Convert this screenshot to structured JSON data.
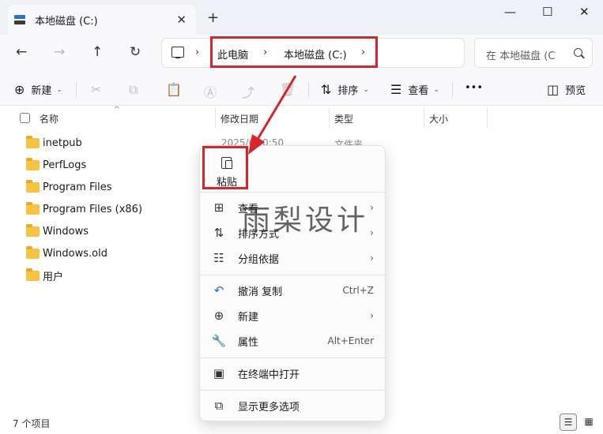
{
  "window": {
    "tab_title": "本地磁盘 (C:)",
    "tab_close_glyph": "✕",
    "new_tab_glyph": "+",
    "minimize_glyph": "—",
    "maximize_glyph": "☐",
    "close_glyph": "✕"
  },
  "nav": {
    "back_glyph": "←",
    "forward_glyph": "→",
    "up_glyph": "↑",
    "refresh_glyph": "↻",
    "chevron_glyph": "›",
    "breadcrumbs": [
      "此电脑",
      "本地磁盘 (C:)"
    ],
    "search_placeholder": "在 本地磁盘 (C"
  },
  "toolbar": {
    "new_label": "新建",
    "new_glyph": "⊕",
    "cut_glyph": "✂",
    "copy_glyph": "⧉",
    "paste_glyph": "📋",
    "rename_glyph": "Ⓐ",
    "share_glyph": "⤴",
    "delete_glyph": "🗑",
    "sort_label": "排序",
    "sort_glyph": "⇅",
    "view_label": "查看",
    "view_glyph": "☰",
    "more_glyph": "•••",
    "preview_label": "预览",
    "preview_glyph": "◫",
    "caret_glyph": "⌄"
  },
  "columns": {
    "name": "名称",
    "modified": "修改日期",
    "type": "类型",
    "size": "大小",
    "sort_caret": "^"
  },
  "files": [
    {
      "name": "inetpub"
    },
    {
      "name": "PerfLogs"
    },
    {
      "name": "Program Files"
    },
    {
      "name": "Program Files (x86)"
    },
    {
      "name": "Windows"
    },
    {
      "name": "Windows.old"
    },
    {
      "name": "用户"
    }
  ],
  "partial_row": {
    "date": "2025/6",
    "time": ":0:50",
    "type": "文件夹"
  },
  "status": {
    "count": "7 个项目",
    "details_glyph": "☰",
    "tiles_glyph": "▦"
  },
  "context_menu": {
    "paste_label": "粘贴",
    "items": [
      {
        "label": "查看",
        "icon": "grid-icon",
        "glyph": "⊞",
        "shortcut": "",
        "arrow": "›"
      },
      {
        "label": "排序方式",
        "icon": "sort-icon",
        "glyph": "⇅",
        "shortcut": "",
        "arrow": "›"
      },
      {
        "label": "分组依据",
        "icon": "group-list-icon",
        "glyph": "☷",
        "shortcut": "",
        "arrow": "›"
      },
      {
        "label": "撤消 复制",
        "icon": "undo-icon",
        "glyph": "↶",
        "shortcut": "Ctrl+Z",
        "arrow": ""
      },
      {
        "label": "新建",
        "icon": "add-circle-icon",
        "glyph": "⊕",
        "shortcut": "",
        "arrow": "›"
      },
      {
        "label": "属性",
        "icon": "wrench-icon",
        "glyph": "🔧",
        "shortcut": "Alt+Enter",
        "arrow": ""
      },
      {
        "label": "在终端中打开",
        "icon": "terminal-icon",
        "glyph": "▣",
        "shortcut": "",
        "arrow": ""
      },
      {
        "label": "显示更多选项",
        "icon": "share-external-icon",
        "glyph": "⧉",
        "shortcut": "",
        "arrow": ""
      }
    ]
  },
  "watermark": "雨梨设计",
  "colors": {
    "annotation_red": "#d7262b",
    "folder_yellow": "#f7c340",
    "accent_blue": "#2c6fcf"
  }
}
